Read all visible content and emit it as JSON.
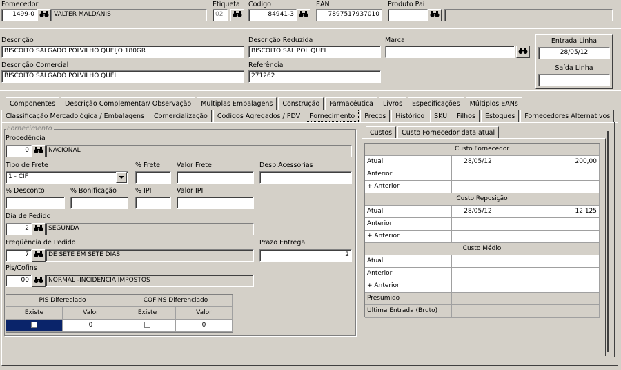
{
  "top": {
    "fornecedor_label": "Fornecedor",
    "fornecedor_code": "1499-0",
    "fornecedor_name": "VALTER MALDANIS",
    "etiqueta_label": "Etiqueta",
    "etiqueta_value": "02",
    "codigo_label": "Código",
    "codigo_value": "84941-3",
    "ean_label": "EAN",
    "ean_value": "7897517937010",
    "produto_pai_label": "Produto Pai",
    "produto_pai_value": "",
    "produto_pai_desc": ""
  },
  "desc": {
    "descricao_label": "Descrição",
    "descricao_value": "BISCOITO SALGADO POLVILHO QUEIJO 180GR",
    "reduzida_label": "Descrição Reduzida",
    "reduzida_value": "BISCOITO SAL POL QUEI",
    "marca_label": "Marca",
    "marca_value": "",
    "comercial_label": "Descrição Comercial",
    "comercial_value": "BISCOITO SALGADO POLVILHO QUEI",
    "referencia_label": "Referência",
    "referencia_value": "271262",
    "entrada_label": "Entrada Linha",
    "entrada_value": "28/05/12",
    "saida_label": "Saída Linha",
    "saida_value": ""
  },
  "tabs_row1": [
    "Componentes",
    "Descrição Complementar/ Observação",
    "Multiplas Embalagens",
    "Construção",
    "Farmacêutica",
    "Livros",
    "Especificações",
    "Múltiplos EANs"
  ],
  "tabs_row2": [
    "Classificação Mercadológica / Embalagens",
    "Comercialização",
    "Códigos Agregados / PDV",
    "Fornecimento",
    "Preços",
    "Histórico",
    "SKU",
    "Filhos",
    "Estoques",
    "Fornecedores Alternativos"
  ],
  "forn": {
    "group_title": "Fornecimento",
    "procedencia_label": "Procedência",
    "procedencia_code": "0",
    "procedencia_desc": "NACIONAL",
    "tipo_frete_label": "Tipo de Frete",
    "tipo_frete_value": "1 - CIF",
    "pct_frete_label": "% Frete",
    "valor_frete_label": "Valor Frete",
    "desp_label": "Desp.Acessórias",
    "pct_desconto_label": "% Desconto",
    "pct_bonif_label": "% Bonificação",
    "pct_ipi_label": "% IPI",
    "valor_ipi_label": "Valor IPI",
    "dia_pedido_label": "Dia de Pedido",
    "dia_pedido_code": "2",
    "dia_pedido_desc": "SEGUNDA",
    "freq_label": "Freqüência de Pedido",
    "freq_code": "7",
    "freq_desc": "DE SETE EM SETE DIAS",
    "prazo_label": "Prazo Entrega",
    "prazo_value": "2",
    "pis_label": "Pis/Cofins",
    "pis_code": "00",
    "pis_desc": "NORMAL -INCIDENCIA IMPOSTOS",
    "pis_dif_header": "PIS Difereciado",
    "cofins_dif_header": "COFINS Diferenciado",
    "existe": "Existe",
    "valor": "Valor",
    "pis_valor": "0",
    "cofins_valor": "0"
  },
  "custos": {
    "tab1": "Custos",
    "tab2": "Custo Fornecedor data atual",
    "fornecedor_header": "Custo Fornecedor",
    "reposicao_header": "Custo Reposição",
    "medio_header": "Custo Médio",
    "atual": "Atual",
    "anterior": "Anterior",
    "mais_anterior": "+ Anterior",
    "presumido": "Presumido",
    "ultima": "Ultima Entrada (Bruto)",
    "forn_atual_date": "28/05/12",
    "forn_atual_value": "200,00",
    "rep_atual_date": "28/05/12",
    "rep_atual_value": "12,125"
  }
}
